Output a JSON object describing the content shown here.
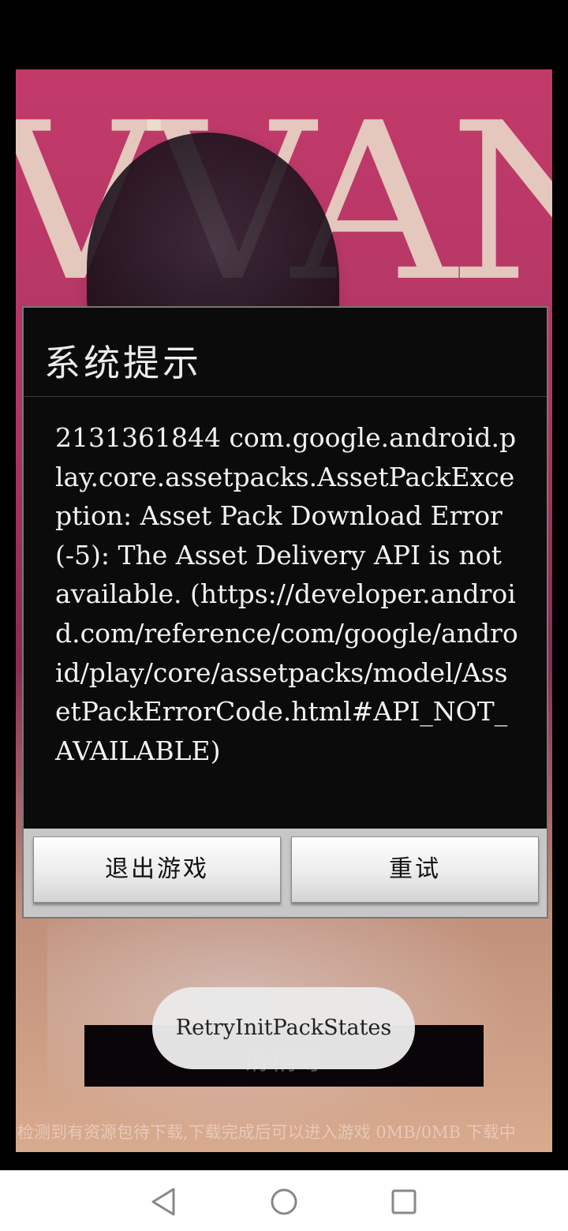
{
  "game": {
    "title_art": "VVANNA",
    "wait_label": "请稍等",
    "status_line": "检测到有资源包待下载,下载完成后可以进入游戏 0MB/0MB 下载中"
  },
  "dialog": {
    "title": "系统提示",
    "message": "2131361844 com.google.android.play.core.assetpacks.AssetPackException: Asset Pack Download Error(-5): The Asset Delivery API is not available. (https://developer.android.com/reference/com/google/android/play/core/assetpacks/model/AssetPackErrorCode.html#API_NOT_AVAILABLE)",
    "buttons": {
      "exit": "退出游戏",
      "retry": "重试"
    }
  },
  "toast": {
    "text": "RetryInitPackStates"
  },
  "navbar": {
    "icons": [
      "back-icon",
      "home-icon",
      "recents-icon"
    ]
  }
}
